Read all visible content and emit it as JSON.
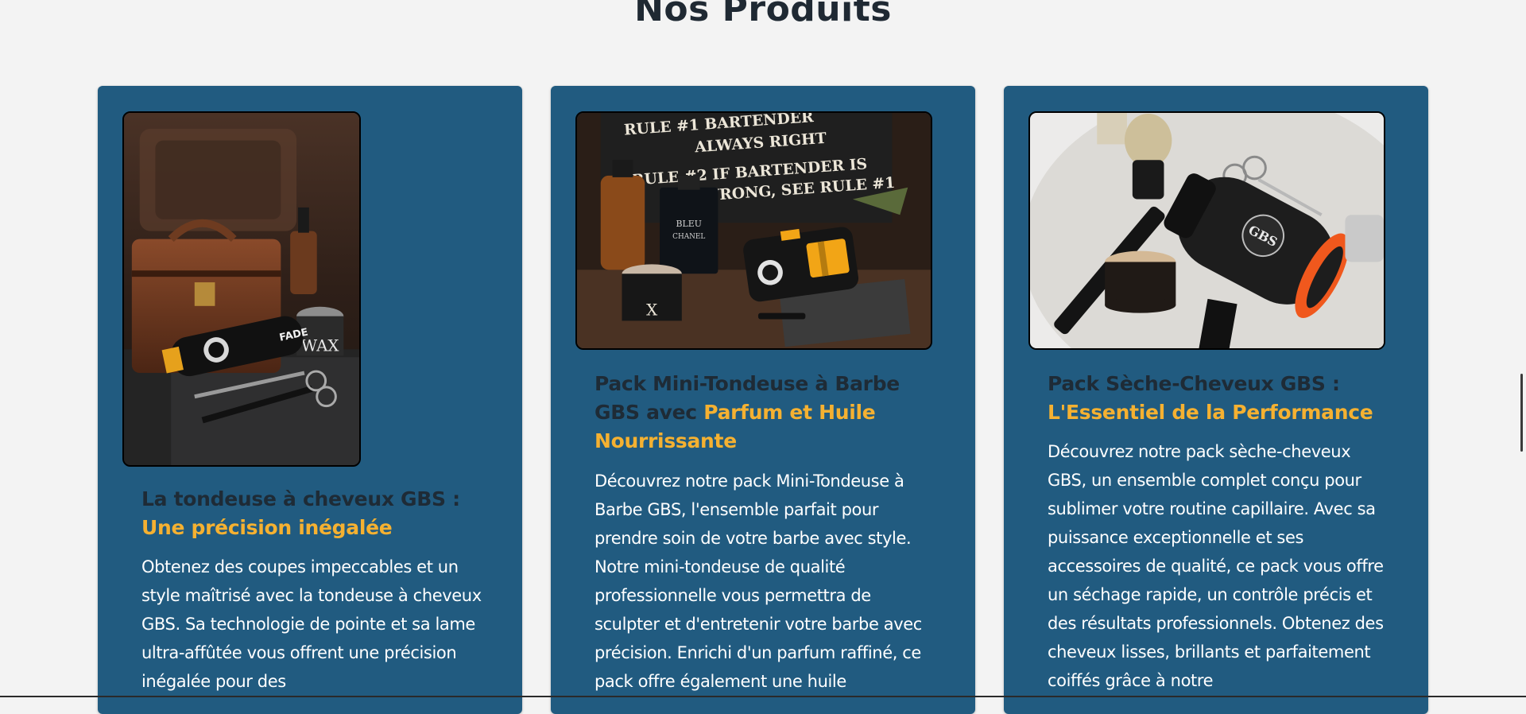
{
  "section": {
    "title": "Nos Produits"
  },
  "products": [
    {
      "title_main": "La tondeuse à cheveux GBS : ",
      "title_accent": "Une précision inégalée",
      "description": "Obtenez des coupes impeccables et un style maîtrisé avec la tondeuse à cheveux GBS. Sa technologie de pointe et sa lame ultra-affûtée vous offrent une précision inégalée pour des",
      "image_labels": {
        "label": "FADE",
        "jar": "WAX"
      }
    },
    {
      "title_main": "Pack Mini-Tondeuse à Barbe GBS avec ",
      "title_accent": "Parfum et Huile Nourrissante",
      "description": "Découvrez notre pack Mini-Tondeuse à Barbe GBS, l'ensemble parfait pour prendre soin de votre barbe avec style. Notre mini-tondeuse de qualité professionnelle vous permettra de sculpter et d'entretenir votre barbe avec précision. Enrichi d'un parfum raffiné, ce pack offre également une huile",
      "image_labels": {
        "sign_line1": "RULE #1 BARTENDER",
        "sign_line2": "ALWAYS RIGHT",
        "sign_line3": "RULE #2 IF BARTENDER IS",
        "sign_line4": "WRONG, SEE RULE #1",
        "perfume1": "BLEU",
        "perfume2": "CHANEL",
        "jar": "X"
      }
    },
    {
      "title_main": "Pack Sèche-Cheveux GBS : ",
      "title_accent": "L'Essentiel de la Performance",
      "description": "Découvrez notre pack sèche-cheveux GBS, un ensemble complet conçu pour sublimer votre routine capillaire. Avec sa puissance exceptionnelle et ses accessoires de qualité, ce pack vous offre un séchage rapide, un contrôle précis et des résultats professionnels. Obtenez des cheveux lisses, brillants et parfaitement coiffés grâce à notre",
      "image_labels": {
        "dryer": "GBS"
      }
    }
  ],
  "colors": {
    "card_bg": "#215b80",
    "accent": "#f5b131",
    "title_dark": "#1e2b36",
    "page_bg": "#f3f3f3"
  }
}
